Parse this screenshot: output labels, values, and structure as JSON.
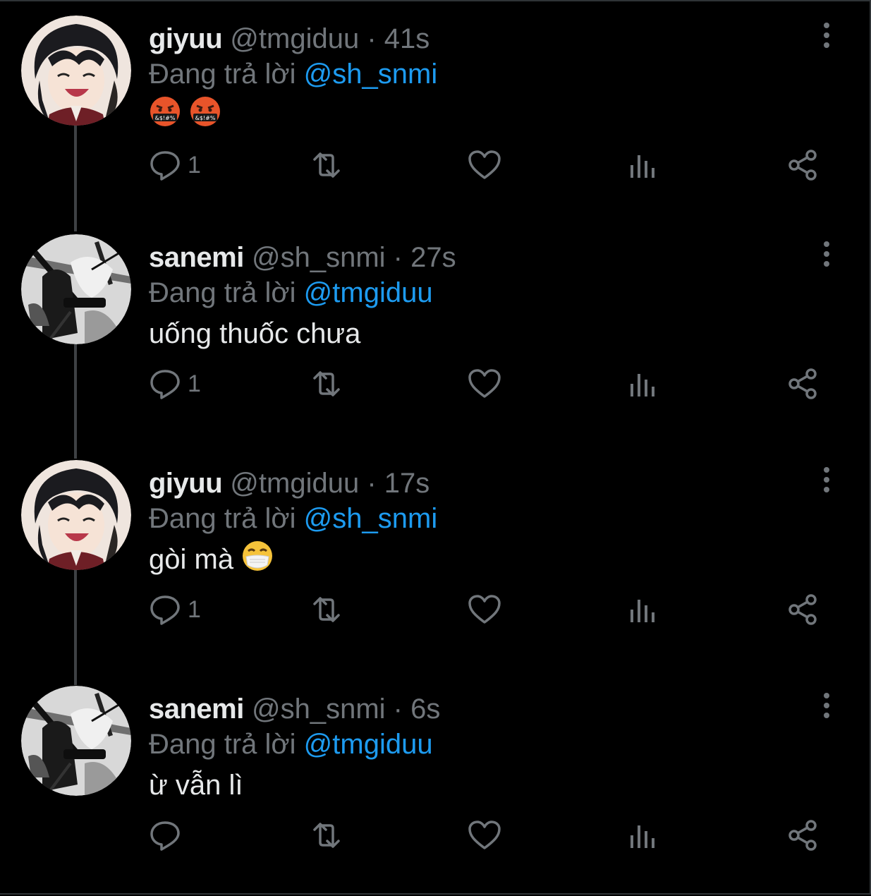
{
  "reply_prefix": "Đang trả lời",
  "colors": {
    "background": "#000000",
    "text": "#e7e9ea",
    "muted": "#71767b",
    "accent": "#1d9bf0",
    "thread_line": "#3e4144"
  },
  "tweets": [
    {
      "name": "giyuu",
      "handle": "@tmgiduu",
      "time": "41s",
      "reply_to": "@sh_snmi",
      "text": "",
      "emoji": [
        "face-with-symbols-on-mouth",
        "face-with-symbols-on-mouth"
      ],
      "reply_count": "1",
      "avatar": "giyuu-avatar"
    },
    {
      "name": "sanemi",
      "handle": "@sh_snmi",
      "time": "27s",
      "reply_to": "@tmgiduu",
      "text": "uống thuốc chưa",
      "emoji": [],
      "reply_count": "1",
      "avatar": "sanemi-avatar"
    },
    {
      "name": "giyuu",
      "handle": "@tmgiduu",
      "time": "17s",
      "reply_to": "@sh_snmi",
      "text": "gòi mà",
      "emoji": [
        "face-with-medical-mask"
      ],
      "reply_count": "1",
      "avatar": "giyuu-avatar"
    },
    {
      "name": "sanemi",
      "handle": "@sh_snmi",
      "time": "6s",
      "reply_to": "@tmgiduu",
      "text": "ừ vẫn lì",
      "emoji": [],
      "reply_count": "",
      "avatar": "sanemi-avatar"
    }
  ],
  "icons": {
    "reply": "reply-icon",
    "retweet": "retweet-icon",
    "like": "heart-icon",
    "views": "views-icon",
    "share": "share-icon",
    "more": "more-vertical-icon"
  }
}
